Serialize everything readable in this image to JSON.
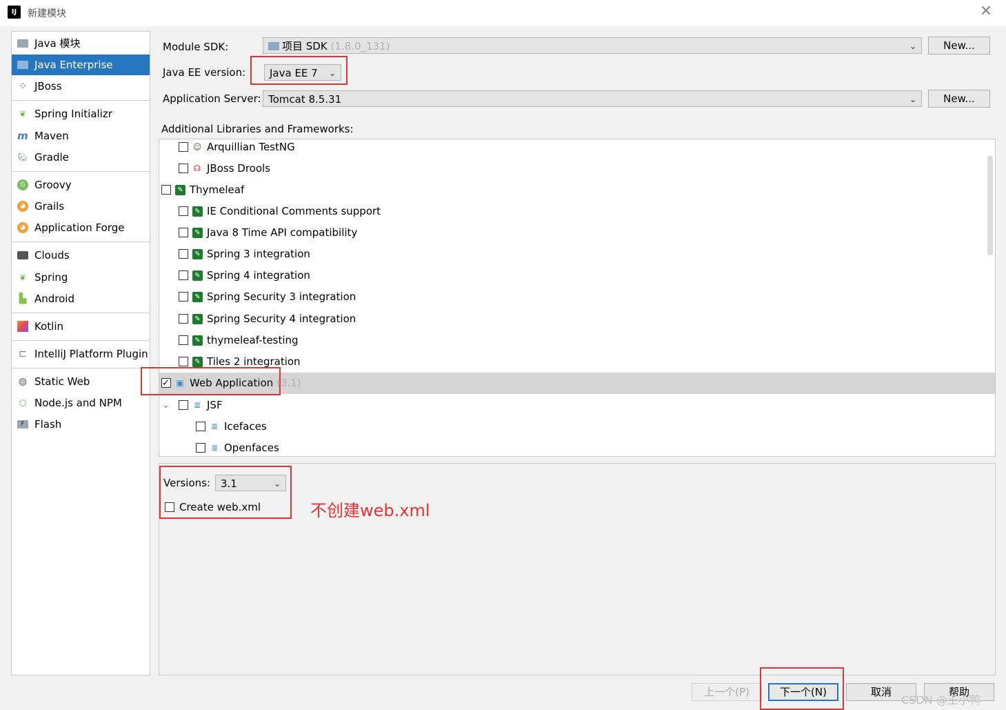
{
  "window": {
    "title": "新建模块",
    "close_glyph": "✕",
    "app_icon": "intellij-icon"
  },
  "left_list": {
    "items": [
      {
        "label": "Java 模块",
        "icon": "folder-icon"
      },
      {
        "label": "Java Enterprise",
        "icon": "java-ee-icon",
        "selected": true
      },
      {
        "label": "JBoss",
        "icon": "jboss-icon"
      },
      {
        "label": "Spring Initializr",
        "icon": "spring-initializr-icon"
      },
      {
        "label": "Maven",
        "icon": "maven-icon"
      },
      {
        "label": "Gradle",
        "icon": "gradle-icon"
      },
      {
        "label": "Groovy",
        "icon": "groovy-icon"
      },
      {
        "label": "Grails",
        "icon": "grails-icon"
      },
      {
        "label": "Application Forge",
        "icon": "forge-icon"
      },
      {
        "label": "Clouds",
        "icon": "clouds-icon"
      },
      {
        "label": "Spring",
        "icon": "spring-icon"
      },
      {
        "label": "Android",
        "icon": "android-icon"
      },
      {
        "label": "Kotlin",
        "icon": "kotlin-icon"
      },
      {
        "label": "IntelliJ Platform Plugin",
        "icon": "plugin-icon"
      },
      {
        "label": "Static Web",
        "icon": "static-web-icon"
      },
      {
        "label": "Node.js and NPM",
        "icon": "nodejs-icon"
      },
      {
        "label": "Flash",
        "icon": "flash-icon"
      }
    ]
  },
  "form": {
    "module_sdk_label": "Module SDK:",
    "module_sdk_value": "项目 SDK",
    "module_sdk_version": "(1.8.0_131)",
    "new_button": "New...",
    "javaee_label": "Java EE version:",
    "javaee_value": "Java EE 7",
    "app_server_label": "Application Server:",
    "app_server_value": "Tomcat 8.5.31",
    "libraries_label": "Additional Libraries and Frameworks:"
  },
  "tree": {
    "rows": [
      {
        "label": "Arquillian TestNG",
        "checked": false,
        "icon": "arquillian-icon",
        "indent": 1
      },
      {
        "label": "JBoss Drools",
        "checked": false,
        "icon": "drools-icon",
        "indent": 1
      },
      {
        "label": "Thymeleaf",
        "checked": false,
        "icon": "thymeleaf-icon",
        "indent": 0
      },
      {
        "label": "IE Conditional Comments support",
        "checked": false,
        "icon": "thymeleaf-icon",
        "indent": 1
      },
      {
        "label": "Java 8 Time API compatibility",
        "checked": false,
        "icon": "thymeleaf-icon",
        "indent": 1
      },
      {
        "label": "Spring 3 integration",
        "checked": false,
        "icon": "thymeleaf-icon",
        "indent": 1
      },
      {
        "label": "Spring 4 integration",
        "checked": false,
        "icon": "thymeleaf-icon",
        "indent": 1
      },
      {
        "label": "Spring Security 3 integration",
        "checked": false,
        "icon": "thymeleaf-icon",
        "indent": 1
      },
      {
        "label": "Spring Security 4 integration",
        "checked": false,
        "icon": "thymeleaf-icon",
        "indent": 1
      },
      {
        "label": "thymeleaf-testing",
        "checked": false,
        "icon": "thymeleaf-icon",
        "indent": 1
      },
      {
        "label": "Tiles 2 integration",
        "checked": false,
        "icon": "thymeleaf-icon",
        "indent": 1
      },
      {
        "label": "Web Application",
        "version": "(3.1)",
        "checked": true,
        "icon": "web-app-icon",
        "indent": 0,
        "highlight": true
      },
      {
        "label": "JSF",
        "checked": false,
        "icon": "jsf-icon",
        "indent": 1,
        "expander": "⌄"
      },
      {
        "label": "Icefaces",
        "checked": false,
        "icon": "jsf-icon",
        "indent": 2
      },
      {
        "label": "Openfaces",
        "checked": false,
        "icon": "jsf-icon",
        "indent": 2
      }
    ]
  },
  "lower": {
    "versions_label": "Versions:",
    "versions_value": "3.1",
    "create_webxml_label": "Create web.xml"
  },
  "annotation": "不创建web.xml",
  "footer": {
    "prev_button": "上一个(P)",
    "next_button": "下一个(N)",
    "cancel_button": "取消",
    "help_button": "帮助",
    "watermark": "CSDN @王小鸭"
  },
  "colors": {
    "selection": "#2675bf",
    "annotation_red": "#e53333",
    "thymeleaf_green": "#1d7a2e"
  }
}
